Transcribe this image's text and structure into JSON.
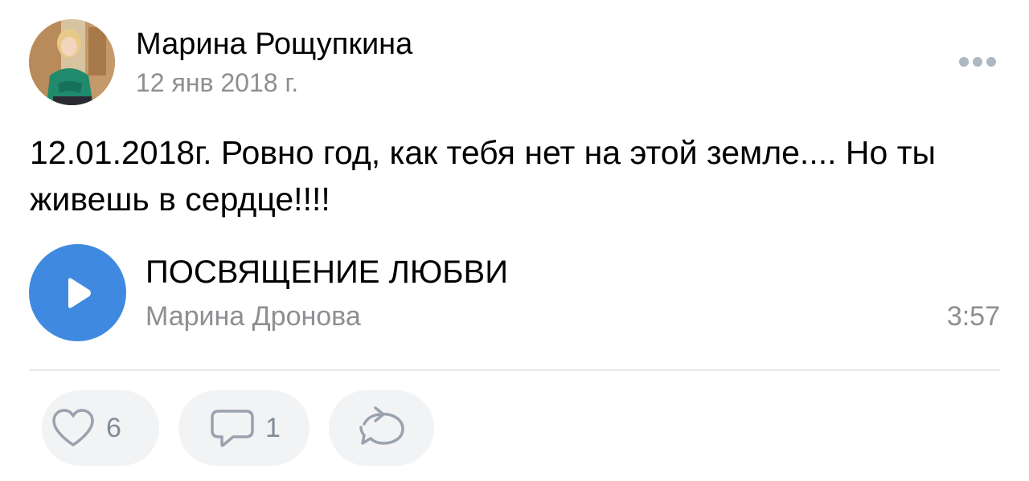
{
  "post": {
    "author": {
      "name": "Марина Рощупкина",
      "avatar_icon": "profile-photo"
    },
    "date": "12 янв 2018 г.",
    "more_icon": "ellipsis-icon",
    "text": "12.01.2018г. Ровно год, как тебя нет на этой земле.... Но ты живешь в сердце!!!!",
    "audio": {
      "play_icon": "play-icon",
      "title": "ПОСВЯЩЕНИЕ ЛЮБВИ",
      "artist": "Марина Дронова",
      "duration": "3:57"
    },
    "actions": {
      "like": {
        "icon": "heart-icon",
        "count": "6"
      },
      "comment": {
        "icon": "comment-icon",
        "count": "1"
      },
      "share": {
        "icon": "share-icon"
      }
    }
  },
  "colors": {
    "accent": "#3f8ae0",
    "secondary_text": "#8e8e93",
    "action_background": "#f2f3f5",
    "icon_gray": "#99a2ad"
  }
}
